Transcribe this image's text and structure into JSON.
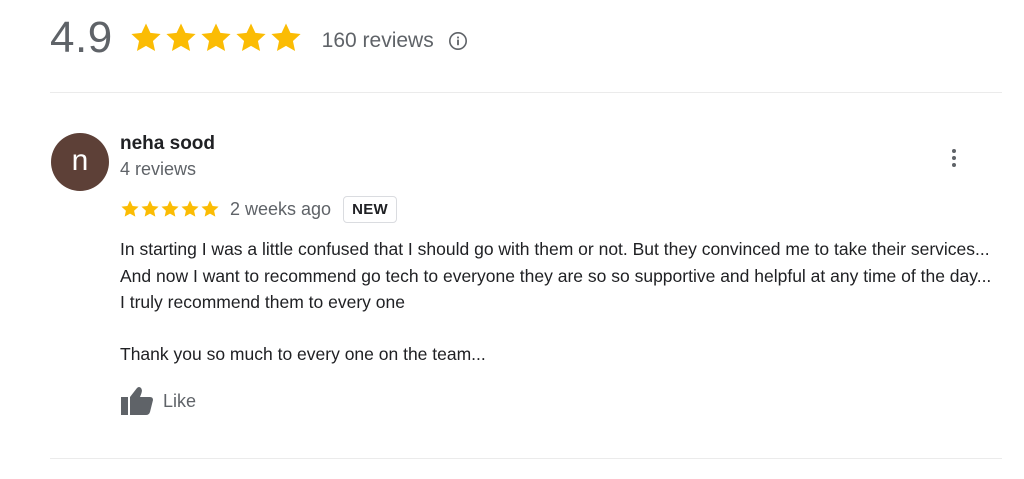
{
  "summary": {
    "rating": "4.9",
    "stars_filled": 5,
    "stars_total": 5,
    "review_count": "160 reviews",
    "info_icon": "info-icon"
  },
  "review": {
    "avatar_initial": "n",
    "avatar_color": "#5d4037",
    "reviewer_name": "neha sood",
    "reviewer_review_count": "4 reviews",
    "stars_filled": 5,
    "date": "2 weeks ago",
    "badge": "NEW",
    "text_paragraph_1": "In starting I was a little confused that I should go with them or not. But they convinced me to take their services... And now I want to recommend go tech to everyone they are so so supportive and helpful at any time of the day... I truly recommend them to every one",
    "text_paragraph_2": "Thank you so much to every one on the team...",
    "like_label": "Like",
    "more_icon": "more-vert-icon",
    "like_icon": "thumbs-up-icon"
  },
  "colors": {
    "star": "#fbbc04",
    "secondary_text": "#5f6368",
    "primary_text": "#202124",
    "divider": "#ebebeb"
  }
}
